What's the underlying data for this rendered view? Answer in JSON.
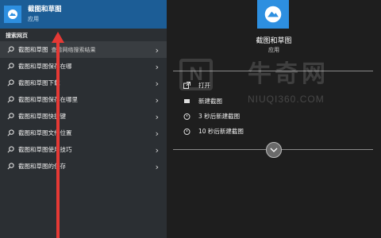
{
  "top_result": {
    "title": "截图和草图",
    "subtitle": "应用"
  },
  "section_label": "搜索网页",
  "results": [
    {
      "text": "截图和草图",
      "hint": "查看网络搜索结果"
    },
    {
      "text": "截图和草图保存在哪"
    },
    {
      "text": "截图和草图下载"
    },
    {
      "text": "截图和草图保存在哪里"
    },
    {
      "text": "截图和草图快捷键"
    },
    {
      "text": "截图和草图文件位置"
    },
    {
      "text": "截图和草图使用技巧"
    },
    {
      "text": "截图和草图的保存"
    }
  ],
  "detail": {
    "title": "截图和草图",
    "subtitle": "应用",
    "actions": [
      {
        "label": "打开",
        "icon": "open-icon"
      },
      {
        "label": "新建截图",
        "icon": "new-snip-icon"
      },
      {
        "label": "3 秒后新建截图",
        "icon": "timer-icon"
      },
      {
        "label": "10 秒后新建截图",
        "icon": "timer-icon"
      }
    ]
  },
  "watermark": {
    "logo_letter": "N",
    "cn": "牛奇网",
    "url": "NIUQI360.COM"
  },
  "colors": {
    "accent": "#2d8fe0",
    "top_bg": "#1c5d96",
    "arrow": "#e53935"
  }
}
